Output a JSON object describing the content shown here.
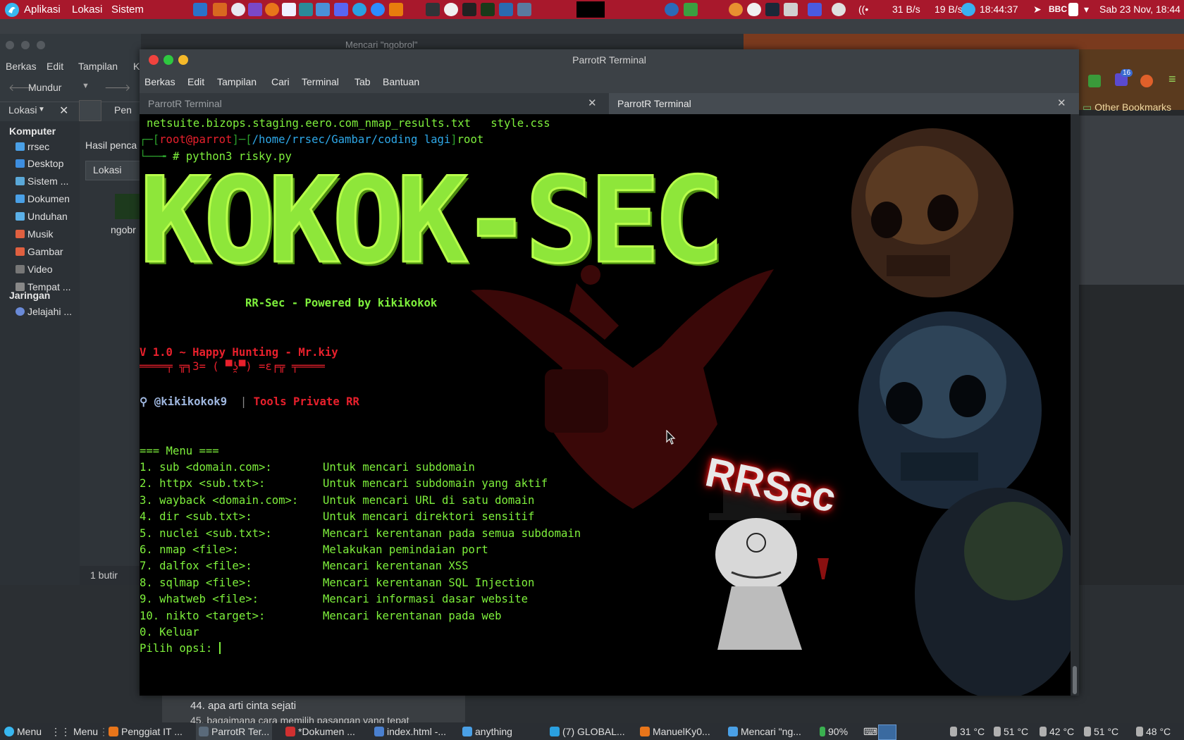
{
  "top_panel": {
    "apps_label": "Aplikasi",
    "places_label": "Lokasi",
    "system_label": "Sistem",
    "net_down": "31 B/s",
    "net_up": "19 B/s",
    "clock": "18:44:37",
    "indicator": "BBC",
    "datetime": "Sab 23 Nov, 18:44"
  },
  "file_manager": {
    "window_title": "Mencari \"ngobrol\"",
    "menu": [
      "Berkas",
      "Edit",
      "Tampilan",
      "K"
    ],
    "back_label": "Mundur",
    "places_label": "Lokasi",
    "sections": {
      "computer": "Komputer",
      "network": "Jaringan"
    },
    "items": [
      {
        "label": "rrsec",
        "color": "#4aa0e6"
      },
      {
        "label": "Desktop",
        "color": "#3d8ee0"
      },
      {
        "label": "Sistem ...",
        "color": "#5aa8d8"
      },
      {
        "label": "Dokumen",
        "color": "#4aa0e6"
      },
      {
        "label": "Unduhan",
        "color": "#5bb0e8"
      },
      {
        "label": "Musik",
        "color": "#e06040"
      },
      {
        "label": "Gambar",
        "color": "#e06040"
      },
      {
        "label": "Video",
        "color": "#777777"
      },
      {
        "label": "Tempat ...",
        "color": "#888888"
      }
    ],
    "network_item": "Jelajahi ...",
    "search_header": "Hasil penca",
    "location_field": "Lokasi",
    "file_name": "ngobr",
    "path_part": "Pen",
    "status": "1 butir"
  },
  "browser": {
    "bookmarks_label": "Other Bookmarks",
    "badge": "16"
  },
  "doc_window": {
    "line1": "44. apa arti cinta sejati",
    "line2": "45. bagaimana cara memilih pasangan yang tepat"
  },
  "terminal": {
    "title": "ParrotR Terminal",
    "menu": [
      "Berkas",
      "Edit",
      "Tampilan",
      "Cari",
      "Terminal",
      "Tab",
      "Bantuan"
    ],
    "tabs": [
      {
        "label": "ParrotR Terminal",
        "active": false
      },
      {
        "label": "ParrotR Terminal",
        "active": true
      }
    ],
    "ls_line": "netsuite.bizops.staging.eero.com_nmap_results.txt   style.css",
    "prompt_user": "root@parrot",
    "prompt_path": "/home/rrsec/Gambar/coding lagi",
    "prompt_suffix": "root",
    "command": "# python3 risky.py",
    "banner": "KOKOK-SEC",
    "powered": "RR-Sec - Powered by kikikokok",
    "version_line": "V 1.0 ~ Happy Hunting - Mr.kiy",
    "kaomoji_line": "════╤ ╦╕3= ( ▀ʖ̯▀) =ε╒╦ ╤════",
    "handle": "@kikikokok9",
    "separator": "|",
    "tools_label": "Tools Private RR",
    "menu_header": "=== Menu ===",
    "menu_items": [
      {
        "cmd": "1. sub <domain.com>:",
        "desc": "Untuk mencari subdomain"
      },
      {
        "cmd": "2. httpx <sub.txt>:",
        "desc": "Untuk mencari subdomain yang aktif"
      },
      {
        "cmd": "3. wayback <domain.com>:",
        "desc": "Untuk mencari URL di satu domain"
      },
      {
        "cmd": "4. dir <sub.txt>:",
        "desc": "Untuk mencari direktori sensitif"
      },
      {
        "cmd": "5. nuclei <sub.txt>:",
        "desc": "Mencari kerentanan pada semua subdomain"
      },
      {
        "cmd": "6. nmap <file>:",
        "desc": "Melakukan pemindaian port"
      },
      {
        "cmd": "7. dalfox <file>:",
        "desc": "Mencari kerentanan XSS"
      },
      {
        "cmd": "8. sqlmap <file>:",
        "desc": "Mencari kerentanan SQL Injection"
      },
      {
        "cmd": "9. whatweb <file>:",
        "desc": "Mencari informasi dasar website"
      },
      {
        "cmd": "10. nikto <target>:",
        "desc": "Mencari kerentanan pada web"
      }
    ],
    "exit_item": "0. Keluar",
    "input_prompt": "Pilih opsi: ",
    "wallpaper_text": "RRSec"
  },
  "taskbar": {
    "menu_label": "Menu",
    "menu2_label": "Menu",
    "items": [
      {
        "label": "Penggiat IT ...",
        "color": "#e8751a"
      },
      {
        "label": "ParrotR Ter...",
        "color": "#5a6a7a"
      },
      {
        "label": "*Dokumen ...",
        "color": "#d03030"
      },
      {
        "label": "index.html -...",
        "color": "#4a80d0"
      },
      {
        "label": "anything",
        "color": "#4aa0e6"
      },
      {
        "label": "(7) GLOBAL...",
        "color": "#2aa0e0"
      },
      {
        "label": "ManuelKy0...",
        "color": "#e8751a"
      },
      {
        "label": "Mencari \"ng...",
        "color": "#4aa0e6"
      }
    ],
    "battery": "90%",
    "temps": [
      "31 °C",
      "51 °C",
      "42 °C",
      "51 °C",
      "48 °C"
    ]
  },
  "colors": {
    "panel_red": "#a8182c",
    "term_green": "#7ef03c",
    "term_red": "#e8202c",
    "banner_green": "#8ee63a"
  }
}
